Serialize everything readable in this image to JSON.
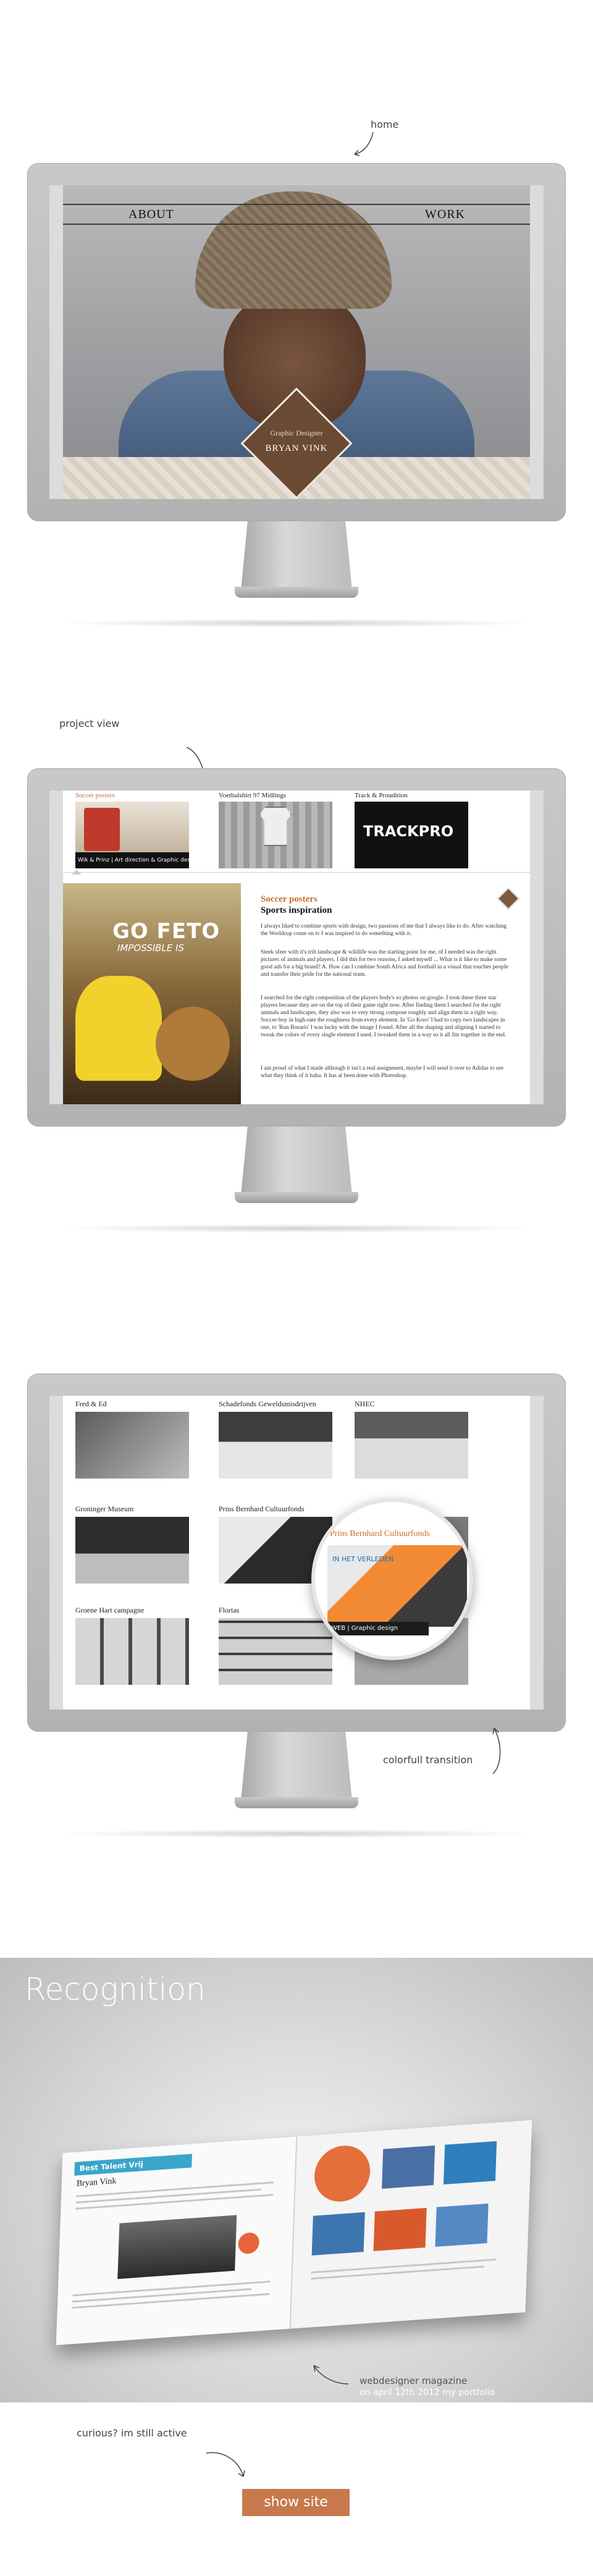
{
  "annotations": {
    "home": "home",
    "project_view": "project view",
    "transition": "colorfull transition",
    "curious": "curious? im still active"
  },
  "home_screen": {
    "nav_about": "ABOUT",
    "nav_work": "WORK",
    "badge_subtitle": "Graphic Designer",
    "badge_name": "BRYAN VINK"
  },
  "project_screen": {
    "thumbs": [
      {
        "title": "Soccer posters",
        "caption": "Wik & Prinz | Art direction & Graphic design"
      },
      {
        "title": "Voetbalshirt 97 Midlings",
        "caption": ""
      },
      {
        "title": "Track & Proudition",
        "caption": "TRACKPRO"
      }
    ],
    "poster_title": "GO FETO",
    "poster_subtitle": "IMPOSSIBLE IS",
    "project_title": "Soccer posters",
    "project_subtitle": "Sports inspiration",
    "paragraphs": [
      "I always liked to combine sports with design, two passions of me that I always like to do. After watching the Worldcup come on tv I was inspired to do something with it.",
      "Steek sfeer with it's trib landscape & wildlife was the starting point for me, of I needed was the right pictures of animals and players. I did this for two reasons, I asked myself ... What is it like to make some good ads for a big brand? A. How can I combine South Africa and football in a visual that touches people and transfer their pride for the national team.",
      "I searched for the right composition of the players body's so photos on google. I took these three star players because they are on the top of their game right now. After finding them I searched for the right animals and landscapes, they also was to very strong compose roughly and align them in a right way. Soccer-boy in high-rate the roughness from every element. In 'Go Koro' I had to copy two landscapes in one, to 'Run Bosaris' I was lucky with the image I found. After all the shaping and aligning I started to tweak the colors of every single element I used. I tweaked them in a way so it all fits together in the end.",
      "I am proud of what I made although it isn't a real assignment, maybe I will send it over to Adidas to see what they think of it haha. It has al been done with Photoshop."
    ]
  },
  "overview_screen": {
    "items": [
      {
        "title": "Fred & Ed"
      },
      {
        "title": "Schadefonds Geweldsmisdrijven"
      },
      {
        "title": "NHEC"
      },
      {
        "title": "Groninger Museum"
      },
      {
        "title": "Prins Bernhard Cultuurfonds"
      },
      {
        "title": ""
      },
      {
        "title": "Groene Hart campagne"
      },
      {
        "title": "Flortas"
      },
      {
        "title": ""
      }
    ],
    "magnifier_title": "Prins Bernhard Cultuurfonds",
    "magnifier_link": "IN HET VERLEDEN",
    "magnifier_caption": "WEB | Graphic design"
  },
  "recognition": {
    "title": "Recognition",
    "magazine_header": "Best Talent Vrij",
    "magazine_name": "Bryan Vink",
    "caption_line1": "webdesigner magazine",
    "caption_line2": "on april 12th 2012 my portfolio"
  },
  "cta": {
    "show_site": "show site"
  }
}
